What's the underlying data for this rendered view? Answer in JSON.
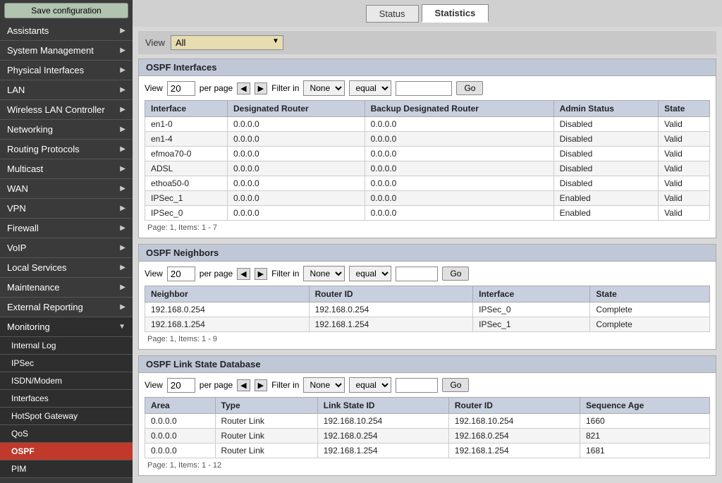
{
  "sidebar": {
    "save_button": "Save configuration",
    "items": [
      {
        "label": "Assistants",
        "expandable": true
      },
      {
        "label": "System Management",
        "expandable": true
      },
      {
        "label": "Physical Interfaces",
        "expandable": true
      },
      {
        "label": "LAN",
        "expandable": true
      },
      {
        "label": "Wireless LAN Controller",
        "expandable": true
      },
      {
        "label": "Networking",
        "expandable": true
      },
      {
        "label": "Routing Protocols",
        "expandable": true
      },
      {
        "label": "Multicast",
        "expandable": true
      },
      {
        "label": "WAN",
        "expandable": true
      },
      {
        "label": "VPN",
        "expandable": true
      },
      {
        "label": "Firewall",
        "expandable": true
      },
      {
        "label": "VoIP",
        "expandable": true
      },
      {
        "label": "Local Services",
        "expandable": true
      },
      {
        "label": "Maintenance",
        "expandable": true
      },
      {
        "label": "External Reporting",
        "expandable": true
      },
      {
        "label": "Monitoring",
        "expandable": true,
        "expanded": true
      }
    ],
    "monitoring_sub": [
      {
        "label": "Internal Log"
      },
      {
        "label": "IPSec"
      },
      {
        "label": "ISDN/Modem"
      },
      {
        "label": "Interfaces"
      },
      {
        "label": "HotSpot Gateway"
      },
      {
        "label": "QoS"
      },
      {
        "label": "OSPF",
        "active": true
      },
      {
        "label": "PIM"
      }
    ]
  },
  "topbar": {
    "status_label": "Status",
    "statistics_label": "Statistics"
  },
  "view_all": {
    "label": "View",
    "option": "All"
  },
  "ospf_interfaces": {
    "title": "OSPF Interfaces",
    "view_label": "View",
    "per_page_label": "per page",
    "filter_label": "Filter in",
    "per_page_value": "20",
    "filter_option": "None",
    "equal_option": "equal",
    "go_label": "Go",
    "columns": [
      "Interface",
      "Designated Router",
      "Backup Designated Router",
      "Admin Status",
      "State"
    ],
    "rows": [
      {
        "interface": "en1-0",
        "designated": "0.0.0.0",
        "backup": "0.0.0.0",
        "admin_status": "Disabled",
        "state": "Valid"
      },
      {
        "interface": "en1-4",
        "designated": "0.0.0.0",
        "backup": "0.0.0.0",
        "admin_status": "Disabled",
        "state": "Valid"
      },
      {
        "interface": "efmoa70-0",
        "designated": "0.0.0.0",
        "backup": "0.0.0.0",
        "admin_status": "Disabled",
        "state": "Valid"
      },
      {
        "interface": "ADSL",
        "designated": "0.0.0.0",
        "backup": "0.0.0.0",
        "admin_status": "Disabled",
        "state": "Valid"
      },
      {
        "interface": "ethoa50-0",
        "designated": "0.0.0.0",
        "backup": "0.0.0.0",
        "admin_status": "Disabled",
        "state": "Valid"
      },
      {
        "interface": "IPSec_1",
        "designated": "0.0.0.0",
        "backup": "0.0.0.0",
        "admin_status": "Enabled",
        "state": "Valid"
      },
      {
        "interface": "IPSec_0",
        "designated": "0.0.0.0",
        "backup": "0.0.0.0",
        "admin_status": "Enabled",
        "state": "Valid"
      }
    ],
    "page_info": "Page: 1, Items: 1 - 7"
  },
  "ospf_neighbors": {
    "title": "OSPF Neighbors",
    "view_label": "View",
    "per_page_label": "per page",
    "filter_label": "Filter in",
    "per_page_value": "20",
    "filter_option": "None",
    "equal_option": "equal",
    "go_label": "Go",
    "columns": [
      "Neighbor",
      "Router ID",
      "Interface",
      "State"
    ],
    "rows": [
      {
        "neighbor": "192.168.0.254",
        "router_id": "192.168.0.254",
        "interface": "IPSec_0",
        "state": "Complete"
      },
      {
        "neighbor": "192.168.1.254",
        "router_id": "192.168.1.254",
        "interface": "IPSec_1",
        "state": "Complete"
      }
    ],
    "page_info": "Page: 1, Items: 1 - 9"
  },
  "ospf_link_state": {
    "title": "OSPF Link State Database",
    "view_label": "View",
    "per_page_label": "per page",
    "filter_label": "Filter in",
    "per_page_value": "20",
    "filter_option": "None",
    "equal_option": "equal",
    "go_label": "Go",
    "columns": [
      "Area",
      "Type",
      "Link State ID",
      "Router ID",
      "Sequence Age"
    ],
    "rows": [
      {
        "area": "0.0.0.0",
        "type": "Router Link",
        "link_state_id": "192.168.10.254",
        "router_id": "192.168.10.254",
        "seq_age": "1660"
      },
      {
        "area": "0.0.0.0",
        "type": "Router Link",
        "link_state_id": "192.168.0.254",
        "router_id": "192.168.0.254",
        "seq_age": "821"
      },
      {
        "area": "0.0.0.0",
        "type": "Router Link",
        "link_state_id": "192.168.1.254",
        "router_id": "192.168.1.254",
        "seq_age": "1681"
      }
    ],
    "page_info": "Page: 1, Items: 1 - 12"
  }
}
